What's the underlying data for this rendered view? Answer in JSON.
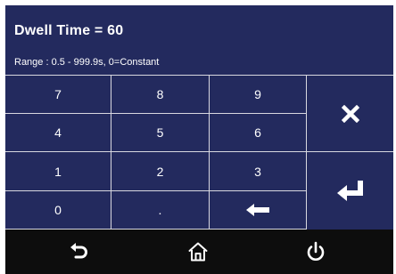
{
  "header": {
    "title": "Dwell Time = 60",
    "range": "Range : 0.5 - 999.9s, 0=Constant"
  },
  "keypad": {
    "keys": [
      {
        "label": "7"
      },
      {
        "label": "8"
      },
      {
        "label": "9"
      },
      {
        "label": "4"
      },
      {
        "label": "5"
      },
      {
        "label": "6"
      },
      {
        "label": "1"
      },
      {
        "label": "2"
      },
      {
        "label": "3"
      },
      {
        "label": "0"
      },
      {
        "label": "."
      }
    ],
    "backspace_icon": "left-arrow-icon",
    "clear_icon": "x-icon",
    "enter_icon": "enter-icon"
  },
  "footer": {
    "back_icon": "back-arrow-icon",
    "home_icon": "home-icon",
    "power_icon": "power-icon"
  }
}
